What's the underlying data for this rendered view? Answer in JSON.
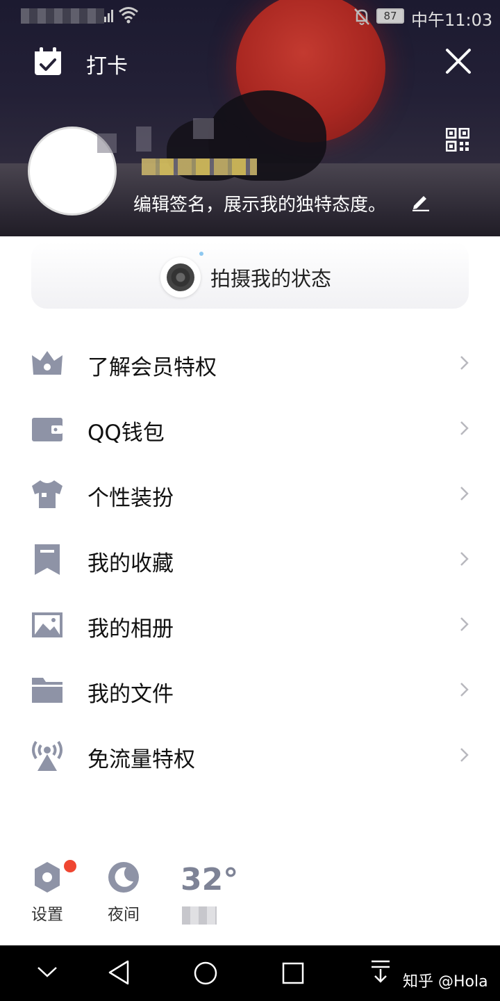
{
  "status_bar": {
    "battery": "87",
    "time": "中午11:03"
  },
  "header": {
    "checkin_label": "打卡",
    "signature": "编辑签名，展示我的独特态度。"
  },
  "status_card": {
    "label": "拍摄我的状态"
  },
  "menu": {
    "items": [
      {
        "label": "了解会员特权",
        "icon": "crown-icon"
      },
      {
        "label": "QQ钱包",
        "icon": "wallet-icon"
      },
      {
        "label": "个性装扮",
        "icon": "shirt-icon"
      },
      {
        "label": "我的收藏",
        "icon": "bookmark-icon"
      },
      {
        "label": "我的相册",
        "icon": "photo-icon"
      },
      {
        "label": "我的文件",
        "icon": "folder-icon"
      },
      {
        "label": "免流量特权",
        "icon": "signal-tower-icon"
      }
    ]
  },
  "bottom": {
    "settings_label": "设置",
    "night_label": "夜间",
    "temperature": "32°"
  },
  "watermark": "知乎 @Hola",
  "colors": {
    "icon_gray": "#8e93a6",
    "badge_red": "#ef4631",
    "chevron": "#b8b8be"
  }
}
